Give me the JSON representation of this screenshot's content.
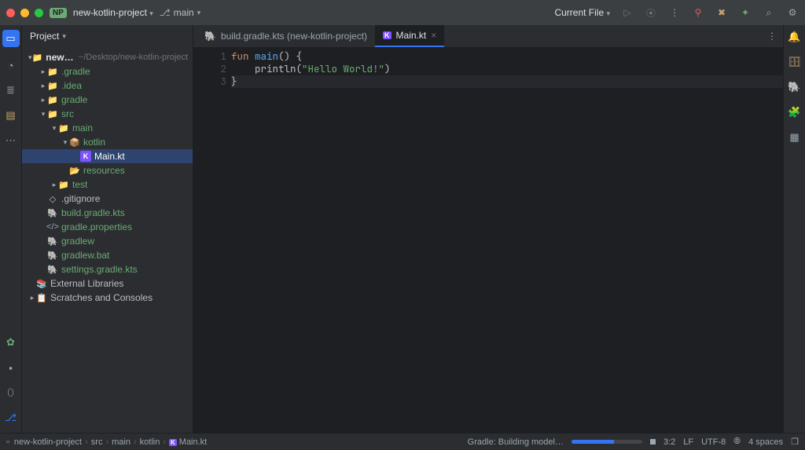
{
  "titlebar": {
    "proj_badge": "NP",
    "project_name": "new-kotlin-project",
    "branch": "main",
    "current_file_label": "Current File"
  },
  "traffic_colors": {
    "close": "#ff5f57",
    "min": "#febc2e",
    "max": "#28c840"
  },
  "accent": "#3574f0",
  "sidebar": {
    "title": "Project",
    "root": {
      "name": "new-kotlin-project",
      "path": "~/Desktop/new-kotlin-project"
    }
  },
  "tree": [
    {
      "depth": 0,
      "expand": "v",
      "icon": "folder",
      "label": "new-kotlin-project",
      "trail": "~/Desktop/new-kotlin-project",
      "bold": true
    },
    {
      "depth": 1,
      "expand": ">",
      "icon": "folder",
      "label": ".gradle",
      "tint": "hl"
    },
    {
      "depth": 1,
      "expand": ">",
      "icon": "folder",
      "label": ".idea",
      "tint": "hl"
    },
    {
      "depth": 1,
      "expand": ">",
      "icon": "folder",
      "label": "gradle",
      "tint": "hl"
    },
    {
      "depth": 1,
      "expand": "v",
      "icon": "src-folder",
      "label": "src",
      "tint": "hl"
    },
    {
      "depth": 2,
      "expand": "v",
      "icon": "folder",
      "label": "main",
      "tint": "hl"
    },
    {
      "depth": 3,
      "expand": "v",
      "icon": "pkg",
      "label": "kotlin",
      "tint": "hl"
    },
    {
      "depth": 4,
      "expand": "",
      "icon": "kotlin",
      "label": "Main.kt",
      "tint": "hl",
      "selected": true
    },
    {
      "depth": 3,
      "expand": "",
      "icon": "res",
      "label": "resources",
      "tint": "hl"
    },
    {
      "depth": 2,
      "expand": ">",
      "icon": "folder",
      "label": "test",
      "tint": "hl"
    },
    {
      "depth": 1,
      "expand": "",
      "icon": "git",
      "label": ".gitignore"
    },
    {
      "depth": 1,
      "expand": "",
      "icon": "gradle",
      "label": "build.gradle.kts",
      "tint": "hl"
    },
    {
      "depth": 1,
      "expand": "",
      "icon": "props",
      "label": "gradle.properties",
      "tint": "hl"
    },
    {
      "depth": 1,
      "expand": "",
      "icon": "gradle",
      "label": "gradlew",
      "tint": "hl"
    },
    {
      "depth": 1,
      "expand": "",
      "icon": "gradle",
      "label": "gradlew.bat",
      "tint": "hl"
    },
    {
      "depth": 1,
      "expand": "",
      "icon": "gradle",
      "label": "settings.gradle.kts",
      "tint": "hl"
    },
    {
      "depth": 0,
      "expand": "",
      "icon": "lib",
      "label": "External Libraries"
    },
    {
      "depth": 0,
      "expand": ">",
      "icon": "scratch",
      "label": "Scratches and Consoles"
    }
  ],
  "tabs": [
    {
      "icon": "gradle",
      "label": "build.gradle.kts (new-kotlin-project)",
      "active": false
    },
    {
      "icon": "kotlin",
      "label": "Main.kt",
      "active": true,
      "closable": true
    }
  ],
  "code": {
    "lines": [
      {
        "n": 1,
        "tokens": [
          [
            "kw",
            "fun "
          ],
          [
            "fn",
            "main"
          ],
          [
            "pn",
            "() {"
          ]
        ]
      },
      {
        "n": 2,
        "tokens": [
          [
            "pn",
            "    println("
          ],
          [
            "str",
            "\"Hello World!\""
          ],
          [
            "pn",
            ")"
          ]
        ]
      },
      {
        "n": 3,
        "tokens": [
          [
            "pn",
            "}"
          ]
        ],
        "current": true
      }
    ]
  },
  "statusbar": {
    "breadcrumbs": [
      "new-kotlin-project",
      "src",
      "main",
      "kotlin",
      "Main.kt"
    ],
    "build_label": "Gradle: Building model…",
    "progress_pct": 60,
    "caret": "3:2",
    "line_sep": "LF",
    "encoding": "UTF-8",
    "indent": "4 spaces"
  },
  "icons": {
    "branch": "⎇",
    "run": "▶",
    "debug": "⦿",
    "more": "⋮",
    "hammer": "🔨",
    "tools": "✖",
    "ai": "✦",
    "search": "⌕",
    "settings": "⚙",
    "bell": "🔔",
    "db": "🗄",
    "chart": "📈",
    "brain": "🧠",
    "grid": "▦",
    "dots": "⋯",
    "lock": "🔒"
  }
}
